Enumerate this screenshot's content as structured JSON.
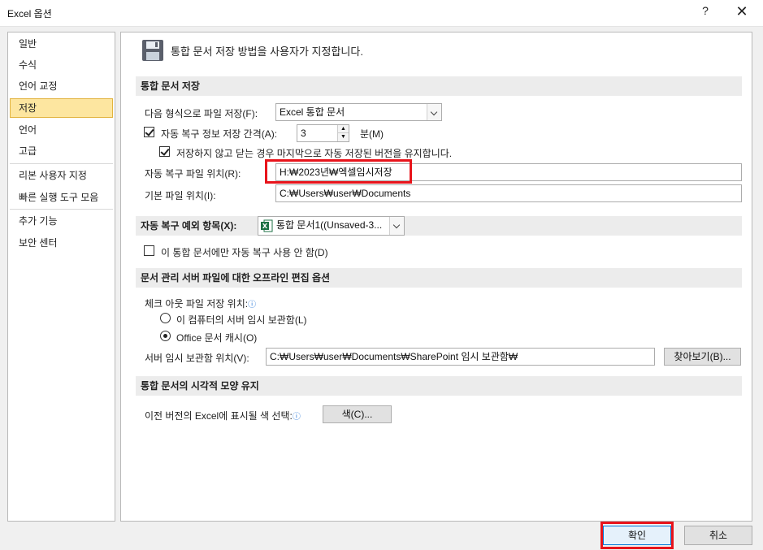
{
  "window": {
    "title": "Excel 옵션",
    "help": "?",
    "close": "✕"
  },
  "sidebar": {
    "items": [
      {
        "label": "일반"
      },
      {
        "label": "수식"
      },
      {
        "label": "언어 교정"
      },
      {
        "label": "저장"
      },
      {
        "label": "언어"
      },
      {
        "label": "고급"
      },
      {
        "label": "리본 사용자 지정"
      },
      {
        "label": "빠른 실행 도구 모음"
      },
      {
        "label": "추가 기능"
      },
      {
        "label": "보안 센터"
      }
    ],
    "active": "저장"
  },
  "header": {
    "text": "통합 문서 저장 방법을 사용자가 지정합니다."
  },
  "save_section": {
    "title": "통합 문서 저장",
    "format_label": "다음 형식으로 파일 저장(F):",
    "format_value": "Excel 통합 문서",
    "autorecover_label": "자동 복구 정보 저장 간격(A):",
    "autorecover_checked": true,
    "autorecover_minutes": "3",
    "minutes_label": "분(M)",
    "keep_last_label": "저장하지 않고 닫는 경우 마지막으로 자동 저장된 버전을 유지합니다.",
    "keep_last_checked": true,
    "autorecover_location_label": "자동 복구 파일 위치(R):",
    "autorecover_location_value": "H:₩2023년₩엑셀임시저장",
    "default_location_label": "기본 파일 위치(I):",
    "default_location_value": "C:₩Users₩user₩Documents"
  },
  "exceptions_section": {
    "title": "자동 복구 예외 항목(X):",
    "workbook_value": "통합 문서1((Unsaved-3...",
    "disable_label": "이 통합 문서에만 자동 복구 사용 안 함(D)",
    "disable_checked": false
  },
  "offline_section": {
    "title": "문서 관리 서버 파일에 대한 오프라인 편집 옵션",
    "checkout_label": "체크 아웃 파일 저장 위치:",
    "option_server": "이 컴퓨터의 서버 임시 보관함(L)",
    "option_cache": "Office 문서 캐시(O)",
    "selected": "cache",
    "drafts_label": "서버 임시 보관함 위치(V):",
    "drafts_value": "C:₩Users₩user₩Documents₩SharePoint 임시 보관함₩",
    "browse_label": "찾아보기(B)..."
  },
  "visual_section": {
    "title": "통합 문서의 시각적 모양 유지",
    "colors_label": "이전 버전의 Excel에 표시될 색 선택:",
    "colors_button": "색(C)..."
  },
  "footer": {
    "ok": "확인",
    "cancel": "취소"
  },
  "colors": {
    "highlight": "#e8141b",
    "active_tab": "#fde6a0",
    "info": "#2b79d8"
  }
}
